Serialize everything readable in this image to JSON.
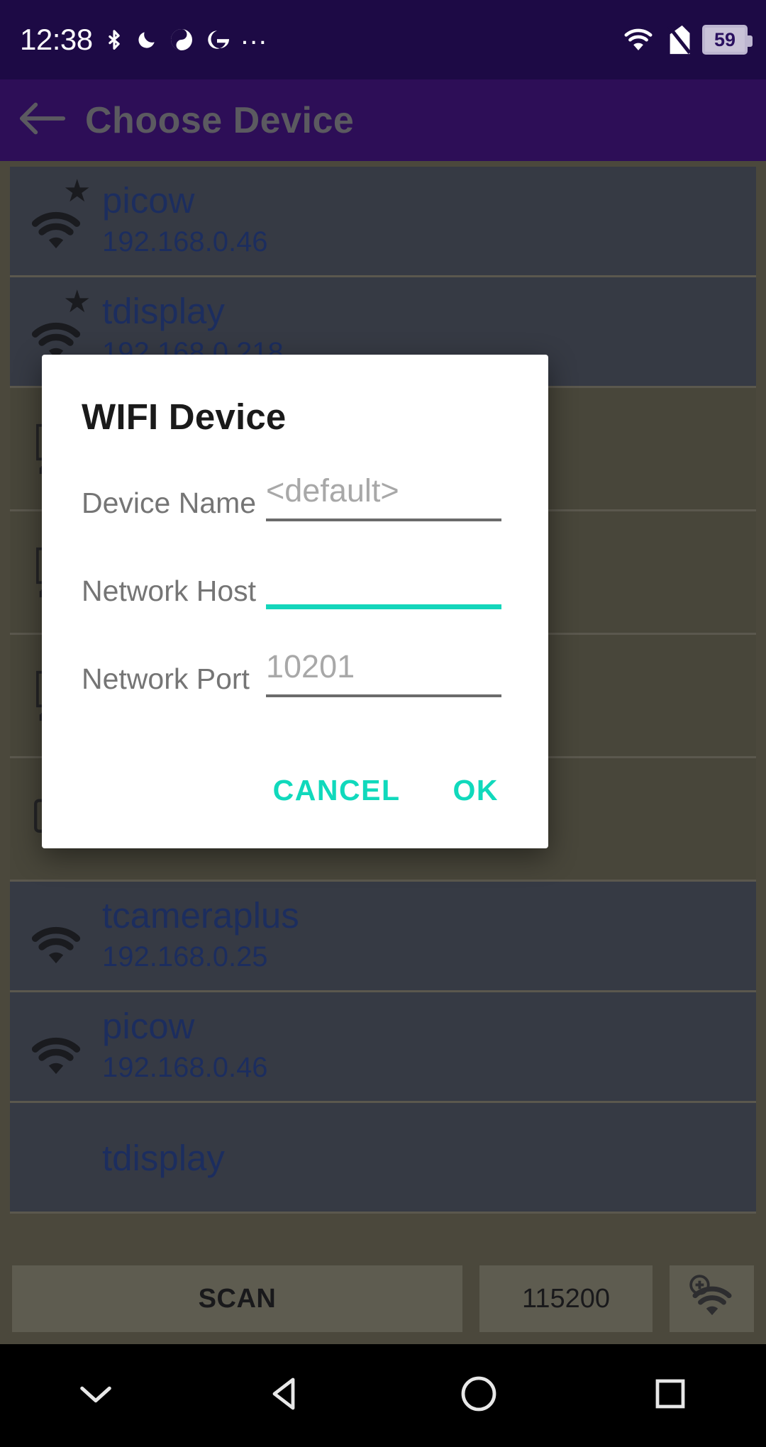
{
  "statusbar": {
    "time": "12:38",
    "icons": [
      "bluetooth-icon",
      "do-not-disturb-moon-icon",
      "sync-icon",
      "google-g-icon",
      "overflow-dots-icon"
    ],
    "dots": "…",
    "wifi_icon": "wifi-icon",
    "no_sim_icon": "no-sim-icon",
    "battery_level": "59"
  },
  "appbar": {
    "back_icon": "back-arrow-icon",
    "title": "Choose Device"
  },
  "device_list": {
    "rows": [
      {
        "type": "wifi",
        "starred": true,
        "star": "★",
        "name": "picow",
        "ip": "192.168.0.46"
      },
      {
        "type": "wifi",
        "starred": true,
        "star": "★",
        "name": "tdisplay",
        "ip": "192.168.0.218"
      },
      {
        "type": "serial",
        "icon": "usb-serial-chip-icon"
      },
      {
        "type": "serial",
        "icon": "usb-serial-chip-icon"
      },
      {
        "type": "serial",
        "icon": "usb-serial-chip-icon"
      },
      {
        "type": "serial",
        "icon": "terminal-device-icon"
      },
      {
        "type": "wifi",
        "starred": false,
        "star": "",
        "name": "tcameraplus",
        "ip": "192.168.0.25"
      },
      {
        "type": "wifi",
        "starred": false,
        "star": "",
        "name": "picow",
        "ip": "192.168.0.46"
      },
      {
        "type": "wifi",
        "starred": false,
        "star": "",
        "name": "tdisplay",
        "ip": ""
      }
    ]
  },
  "bottombar": {
    "scan_label": "SCAN",
    "baud_label": "115200",
    "add_wifi_icon": "add-wifi-icon"
  },
  "dialog": {
    "title": "WIFI Device",
    "fields": [
      {
        "label": "Device Name",
        "value": "<default>",
        "placeholder": "<default>",
        "focused": false
      },
      {
        "label": "Network Host",
        "value": "",
        "placeholder": "",
        "focused": true
      },
      {
        "label": "Network Port",
        "value": "10201",
        "placeholder": "10201",
        "focused": false
      }
    ],
    "cancel_label": "CANCEL",
    "ok_label": "OK"
  },
  "navbar": {
    "hide_keyboard_icon": "chevron-down-icon",
    "back_icon": "triangle-back-icon",
    "home_icon": "circle-home-icon",
    "recents_icon": "square-recents-icon"
  },
  "colors": {
    "status_bar": "#1d0a45",
    "app_bar": "#3a0082",
    "accent_teal": "#10d9bc",
    "device_name_blue": "#1b3a8f",
    "list_card": "#4a5160",
    "list_background": "#6f6a50"
  }
}
